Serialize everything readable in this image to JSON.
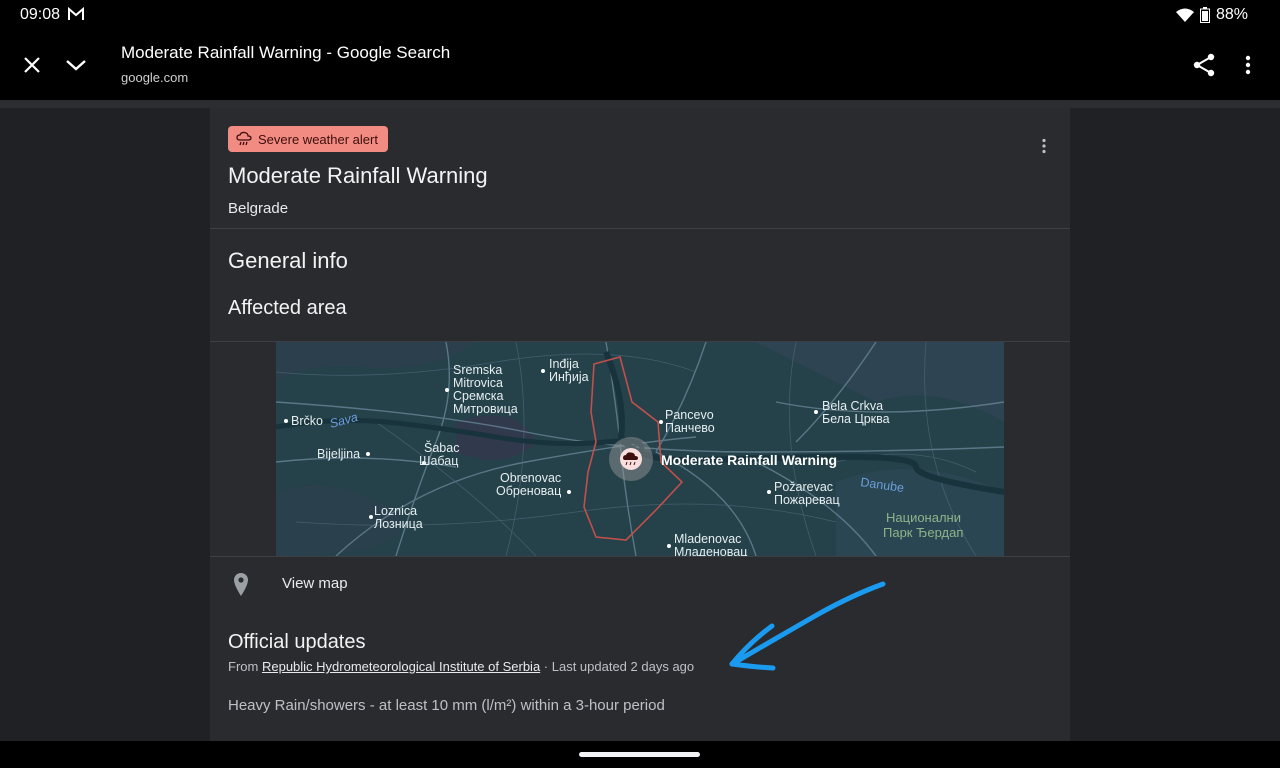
{
  "status_bar": {
    "time": "09:08",
    "battery": "88%"
  },
  "top_bar": {
    "title": "Moderate Rainfall Warning - Google Search",
    "url": "google.com"
  },
  "alert": {
    "badge": "Severe weather alert",
    "title": "Moderate Rainfall Warning",
    "location": "Belgrade"
  },
  "sections": {
    "general_info": "General info",
    "affected_area": "Affected area",
    "official_updates": "Official updates"
  },
  "map": {
    "marker_label": "Moderate Rainfall Warning",
    "labels": [
      {
        "id": "indjija",
        "lines": [
          "Inđija",
          "Инђија"
        ]
      },
      {
        "id": "sremska",
        "lines": [
          "Sremska",
          "Mitrovica",
          "Сремска",
          "Митровица"
        ]
      },
      {
        "id": "brcko",
        "lines": [
          "Brčko"
        ]
      },
      {
        "id": "sava",
        "lines": [
          "Sava"
        ]
      },
      {
        "id": "sabac",
        "lines": [
          "Šabac",
          "Шабац"
        ]
      },
      {
        "id": "bijeljina",
        "lines": [
          "Bijeljina"
        ]
      },
      {
        "id": "obrenovac",
        "lines": [
          "Obrenovac",
          "Обреновац"
        ]
      },
      {
        "id": "pancevo",
        "lines": [
          "Pancevo",
          "Панчево"
        ]
      },
      {
        "id": "bela-crkva",
        "lines": [
          "Bela Crkva",
          "Бела Црква"
        ]
      },
      {
        "id": "danube",
        "lines": [
          "Danube"
        ]
      },
      {
        "id": "pozarevac",
        "lines": [
          "Požarevac",
          "Пожаревац"
        ]
      },
      {
        "id": "nacionalni",
        "lines": [
          "Национални",
          "Парк Ђердап"
        ]
      },
      {
        "id": "loznica",
        "lines": [
          "Loznica",
          "Лозница"
        ]
      },
      {
        "id": "mladenovac",
        "lines": [
          "Mladenovac",
          "Младеновац"
        ]
      }
    ]
  },
  "view_map": {
    "label": "View map"
  },
  "updates": {
    "from_prefix": "From",
    "source": "Republic Hydrometeorological Institute of Serbia",
    "updated": "· Last updated 2 days ago",
    "description": "Heavy Rain/showers - at least 10 mm (l/m²)  within a 3-hour period"
  },
  "colors": {
    "badge_bg": "#f28b82",
    "map_water": "#1d3a44",
    "warning_outline": "#c0504d",
    "annotation_arrow": "#1a9bf0"
  }
}
